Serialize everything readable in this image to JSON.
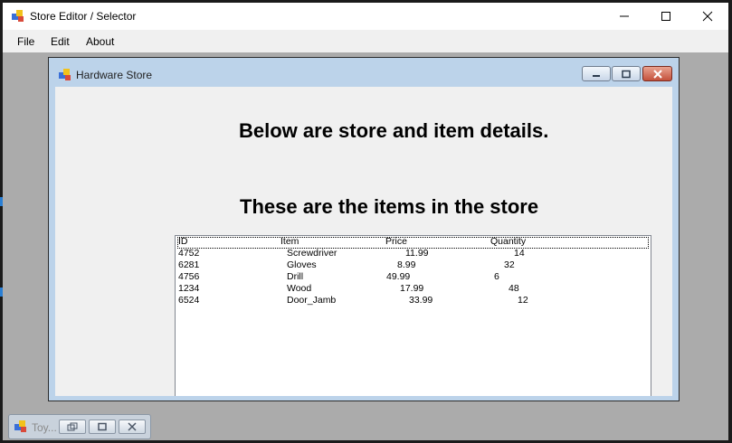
{
  "app": {
    "title": "Store Editor / Selector",
    "icon": "app-window-icon",
    "menu": [
      "File",
      "Edit",
      "About"
    ]
  },
  "child_window": {
    "title": "Hardware Store",
    "heading_top": "Below are store and item details.",
    "heading_items": "These are the items in the store",
    "columns": [
      "ID",
      "Item",
      "Price",
      "Quantity"
    ],
    "rows": [
      {
        "id": "4752",
        "item": "Screwdriver",
        "price": "11.99",
        "quantity": "14"
      },
      {
        "id": "6281",
        "item": "Gloves",
        "price": "8.99",
        "quantity": "32"
      },
      {
        "id": "4756",
        "item": "Drill",
        "price": "49.99",
        "quantity": "6"
      },
      {
        "id": "1234",
        "item": "Wood",
        "price": "17.99",
        "quantity": "48"
      },
      {
        "id": "6524",
        "item": "Door_Jamb",
        "price": "33.99",
        "quantity": "12"
      }
    ]
  },
  "minimized_window": {
    "title": "Toy..."
  },
  "colors": {
    "mdi_background": "#ababab",
    "child_frame": "#bcd3ea",
    "close_button": "#c4513c"
  }
}
